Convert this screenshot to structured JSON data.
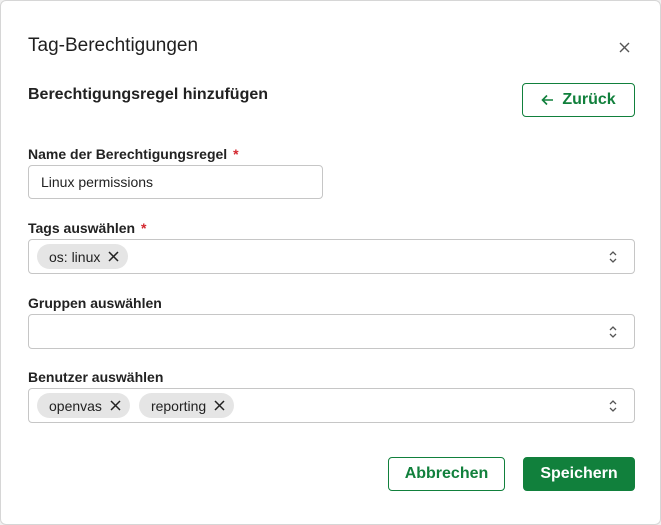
{
  "dialog": {
    "title": "Tag-Berechtigungen",
    "close_icon": "close-icon"
  },
  "form": {
    "subtitle": "Berechtigungsregel hinzufügen",
    "back_label": "Zurück",
    "required_marker": "*",
    "name_field": {
      "label": "Name der Berechtigungsregel",
      "value": "Linux permissions"
    },
    "tags_field": {
      "label": "Tags auswählen",
      "chips": [
        "os: linux"
      ]
    },
    "groups_field": {
      "label": "Gruppen auswählen",
      "chips": []
    },
    "users_field": {
      "label": "Benutzer auswählen",
      "chips": [
        "openvas",
        "reporting"
      ]
    }
  },
  "actions": {
    "cancel_label": "Abbrechen",
    "save_label": "Speichern"
  },
  "colors": {
    "accent": "#11803c",
    "required": "#d3272e",
    "chip_bg": "#e5e5e5"
  }
}
